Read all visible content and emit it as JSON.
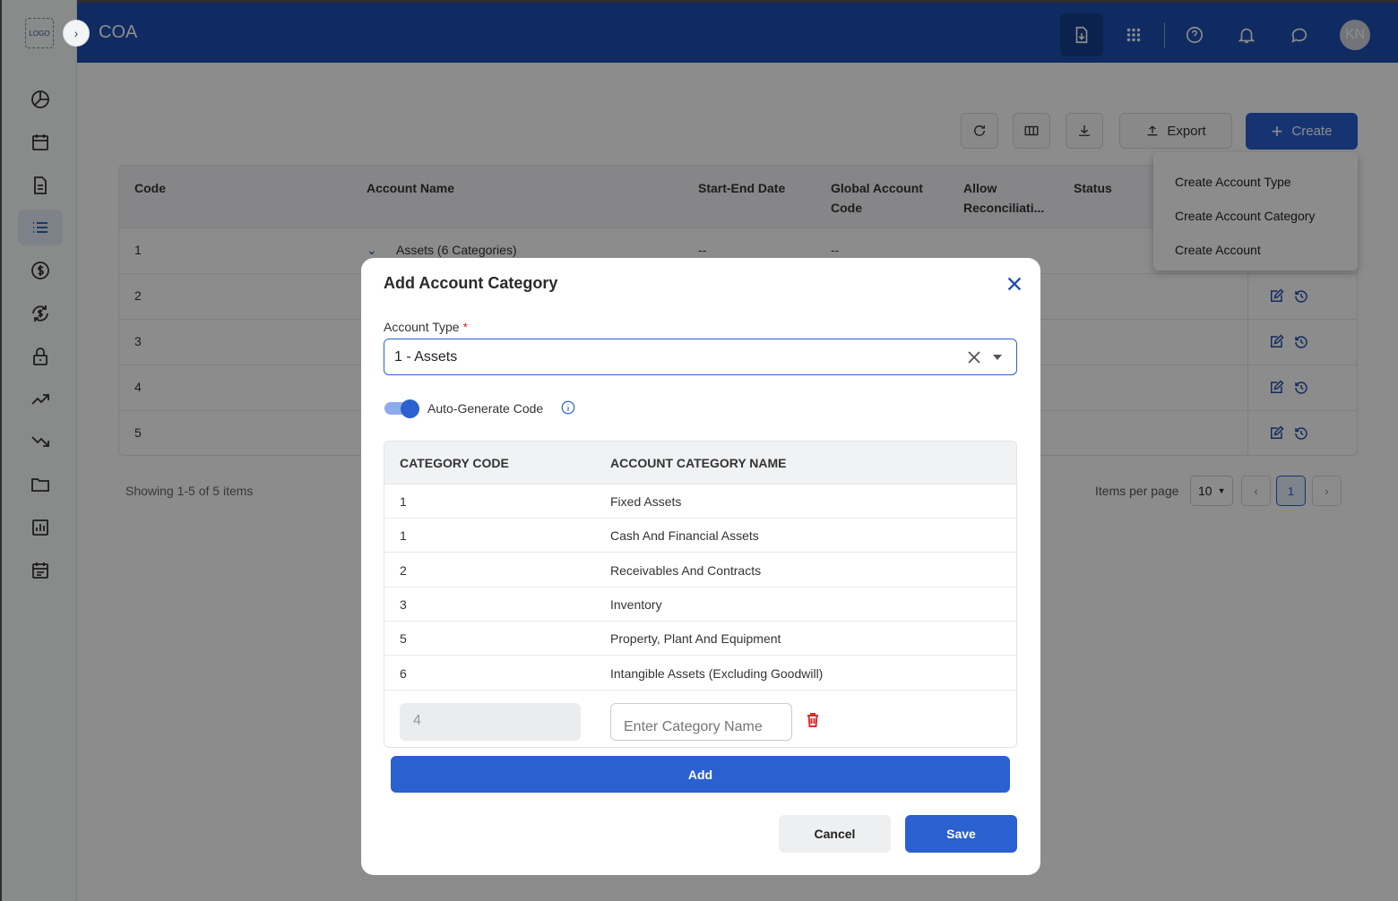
{
  "app": {
    "logo_text": "LOGO",
    "title": "COA",
    "avatar_initials": "KN"
  },
  "sidebar": {
    "icons": [
      "pie-chart-icon",
      "calendar-icon",
      "document-icon",
      "list-icon",
      "dollar-icon",
      "currency-exchange-icon",
      "lock-icon",
      "trending-up-icon",
      "trending-down-icon",
      "folder-icon",
      "bar-chart-icon",
      "schedule-icon"
    ],
    "active_index": 3
  },
  "topbar": {
    "icons": [
      "download-document-icon",
      "apps-grid-icon",
      "help-icon",
      "bell-icon",
      "chat-icon"
    ]
  },
  "toolbar": {
    "export_label": "Export",
    "create_label": "Create"
  },
  "table": {
    "headers": {
      "code": "Code",
      "account_name": "Account Name",
      "start_end_date": "Start-End Date",
      "global_code_1": "Global Account",
      "global_code_2": "Code",
      "allow_recon_1": "Allow",
      "allow_recon_2": "Reconciliati...",
      "status": "Status"
    },
    "rows": [
      {
        "code": "1",
        "name": "Assets (6 Categories)",
        "date": "--",
        "global": "--"
      },
      {
        "code": "2"
      },
      {
        "code": "3"
      },
      {
        "code": "4"
      },
      {
        "code": "5"
      }
    ]
  },
  "pagination": {
    "showing": "Showing 1-5 of 5 items",
    "items_per_page_label": "Items per page",
    "items_per_page": "10",
    "current_page": "1"
  },
  "create_menu": {
    "items": [
      "Create Account Type",
      "Create Account Category",
      "Create Account"
    ]
  },
  "modal": {
    "title": "Add Account Category",
    "account_type_label": "Account Type",
    "required_mark": "*",
    "account_type_value": "1 - Assets",
    "auto_generate_label": "Auto-Generate Code",
    "auto_generate_on": true,
    "table_headers": {
      "code": "CATEGORY CODE",
      "name": "ACCOUNT CATEGORY NAME"
    },
    "categories": [
      {
        "code": "1",
        "name": "Fixed Assets"
      },
      {
        "code": "1",
        "name": "Cash And Financial Assets"
      },
      {
        "code": "2",
        "name": "Receivables And Contracts"
      },
      {
        "code": "3",
        "name": "Inventory"
      },
      {
        "code": "5",
        "name": "Property, Plant And Equipment"
      },
      {
        "code": "6",
        "name": "Intangible Assets (Excluding Goodwill)"
      }
    ],
    "new_code_value": "4",
    "new_name_placeholder": "Enter Category Name",
    "add_label": "Add",
    "cancel_label": "Cancel",
    "save_label": "Save"
  }
}
